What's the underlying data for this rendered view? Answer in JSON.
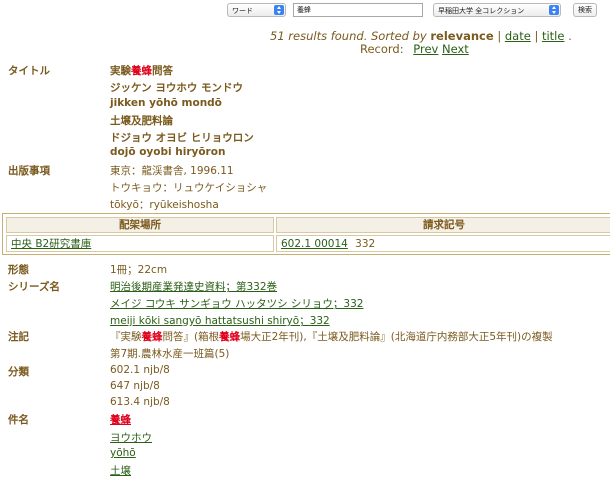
{
  "search": {
    "field_select": "ワード",
    "query": "養蜂",
    "collection_select": "早稲田大学 全コレクション",
    "search_button": "検索"
  },
  "summary": {
    "count_text": "51 results found",
    "sorted_by_text": ". Sorted by",
    "sort_relevance": "relevance",
    "sep1": "|",
    "sort_date": "date",
    "sep2": "|",
    "sort_title": "title",
    "dot": ".",
    "record_label": "Record:",
    "prev": "Prev",
    "next": "Next"
  },
  "labels": {
    "title": "タイトル",
    "publication": "出版事項",
    "format": "形態",
    "series": "シリーズ名",
    "notes": "注記",
    "classification": "分類",
    "subject": "件名"
  },
  "title_lines": {
    "l1_pre": "実験",
    "l1_hl": "養蜂",
    "l1_post": "問答",
    "l2": "ジッケン ヨウホウ モンドウ",
    "l3": "jikken yōhō mondō",
    "l4": "土壌及肥料論",
    "l5": "ドジョウ オヨビ ヒリョウロン",
    "l6": "dojō oyobi hiryōron"
  },
  "publication": {
    "l1": "東京：龍渓書舎, 1996.11",
    "l2": "トウキョウ：リュウケイショシャ",
    "l3": "tōkyō：ryūkeishosha"
  },
  "holdings": {
    "col_location": "配架場所",
    "col_callno": "請求記号",
    "location": "中央 B2研究書庫",
    "callno_link": "602.1 00014",
    "callno_extra": "332"
  },
  "format": "1冊；22cm",
  "series": {
    "l1": "明治後期産業発達史資料；第332巻",
    "l2": "メイジ コウキ サンギョウ ハッタツシ シリョウ；332",
    "l3": "meiji kōki sangyō hattatsushi shiryō；332"
  },
  "notes": {
    "a1": "『実験",
    "a2": "養蜂",
    "a3": "問答』(箱根",
    "a4": "養蜂",
    "a5": "場大正2年刊),『土壌及肥料論』(北海道庁内務部大正5年刊)の複製",
    "l2": "第7期.農林水産一班篇(5)"
  },
  "classification": {
    "l1": "602.1 njb/8",
    "l2": "647 njb/8",
    "l3": "613.4 njb/8"
  },
  "subjects": {
    "s1": "養蜂",
    "s2": "ヨウホウ",
    "s3": "yōhō",
    "s4": "土壌"
  },
  "colors": {
    "text": "#7a5a1e",
    "link": "#2a5f16",
    "highlight": "#e0001b"
  }
}
